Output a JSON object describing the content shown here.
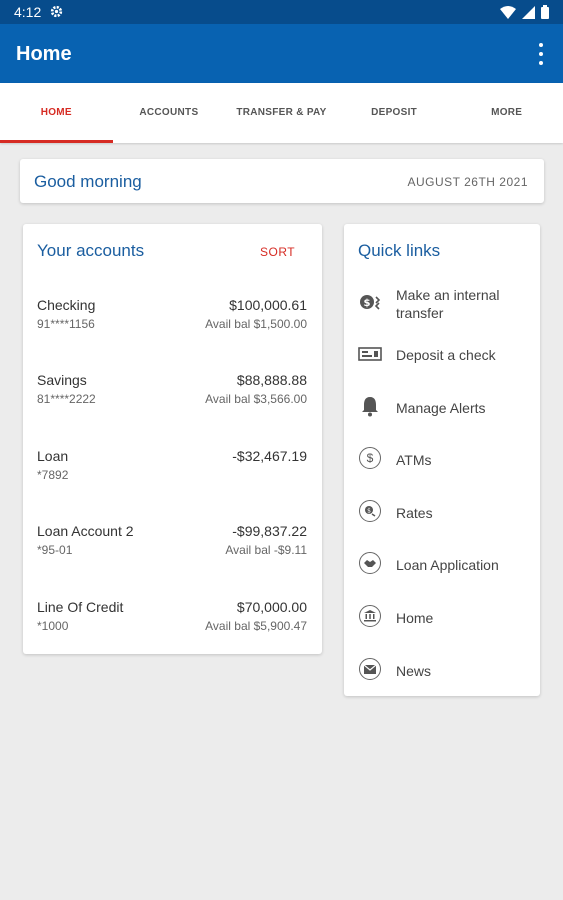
{
  "status": {
    "time": "4:12"
  },
  "appbar": {
    "title": "Home"
  },
  "tabs": [
    {
      "label": "HOME",
      "active": true
    },
    {
      "label": "ACCOUNTS"
    },
    {
      "label": "TRANSFER & PAY"
    },
    {
      "label": "DEPOSIT"
    },
    {
      "label": "MORE"
    }
  ],
  "greeting": {
    "text": "Good morning",
    "date": "AUGUST 26TH 2021"
  },
  "accounts": {
    "title": "Your accounts",
    "sort_label": "SORT",
    "items": [
      {
        "name": "Checking",
        "number": "91****1156",
        "balance": "$100,000.61",
        "avail": "Avail bal $1,500.00"
      },
      {
        "name": "Savings",
        "number": "81****2222",
        "balance": "$88,888.88",
        "avail": "Avail bal $3,566.00"
      },
      {
        "name": "Loan",
        "number": "*7892",
        "balance": "-$32,467.19",
        "avail": ""
      },
      {
        "name": "Loan Account 2",
        "number": "*95-01",
        "balance": "-$99,837.22",
        "avail": "Avail bal -$9.11"
      },
      {
        "name": "Line Of Credit",
        "number": "*1000",
        "balance": "$70,000.00",
        "avail": "Avail bal $5,900.47"
      }
    ]
  },
  "quick_links": {
    "title": "Quick links",
    "items": [
      {
        "label": "Make an internal transfer",
        "icon": "transfer-icon"
      },
      {
        "label": "Deposit a check",
        "icon": "check-icon"
      },
      {
        "label": "Manage Alerts",
        "icon": "bell-icon"
      },
      {
        "label": "ATMs",
        "icon": "dollar-icon"
      },
      {
        "label": "Rates",
        "icon": "rates-icon"
      },
      {
        "label": "Loan Application",
        "icon": "handshake-icon"
      },
      {
        "label": "Home",
        "icon": "bank-icon"
      },
      {
        "label": "News",
        "icon": "mail-icon"
      }
    ]
  },
  "colors": {
    "statusbar": "#074c8c",
    "appbar": "#0862b1",
    "accent": "#d62b23",
    "title_blue": "#1b5ea0"
  }
}
